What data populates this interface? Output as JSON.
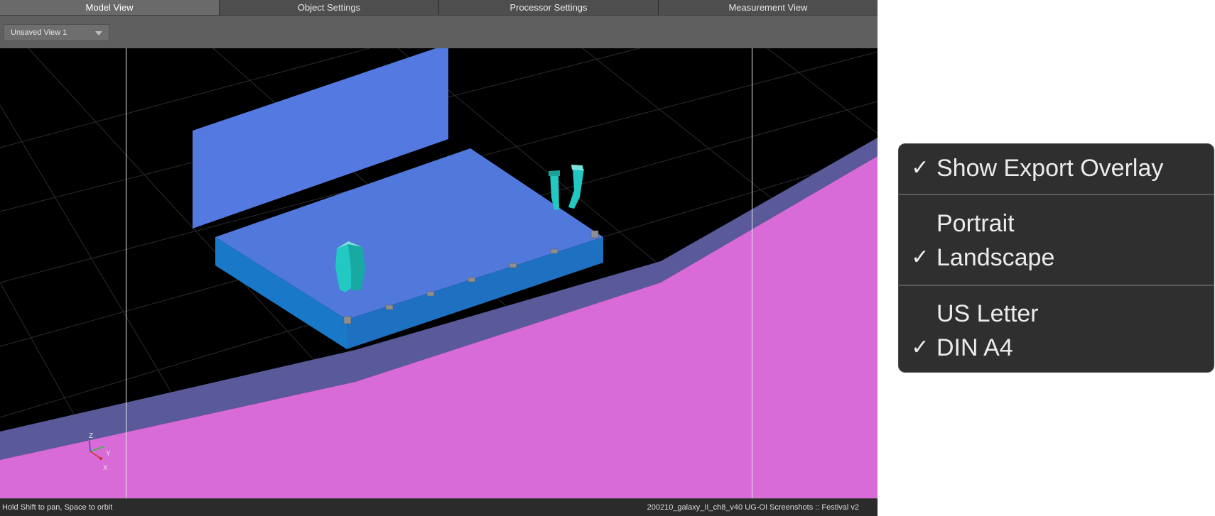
{
  "tabs": [
    {
      "label": "Model View",
      "active": true
    },
    {
      "label": "Object Settings",
      "active": false
    },
    {
      "label": "Processor Settings",
      "active": false
    },
    {
      "label": "Measurement View",
      "active": false
    }
  ],
  "toolbar": {
    "view_select_value": "Unsaved View 1"
  },
  "viewport": {
    "axes": {
      "z": "Z",
      "y": "Y",
      "x": "X"
    },
    "colors": {
      "background": "#000000",
      "screen": "#5479e0",
      "stage": "#5179dc",
      "ground": "#d86bd8",
      "speaker": "#20c9c0"
    }
  },
  "status": {
    "hint": "Hold Shift to pan, Space to orbit",
    "document": "200210_galaxy_II_ch8_v40 UG-OI Screenshots :: Festival v2"
  },
  "menu": {
    "items": [
      {
        "label": "Show Export Overlay",
        "checked": true
      },
      {
        "label": "Portrait",
        "checked": false
      },
      {
        "label": "Landscape",
        "checked": true
      },
      {
        "label": "US Letter",
        "checked": false
      },
      {
        "label": "DIN A4",
        "checked": true
      }
    ],
    "check_glyph": "✓"
  }
}
